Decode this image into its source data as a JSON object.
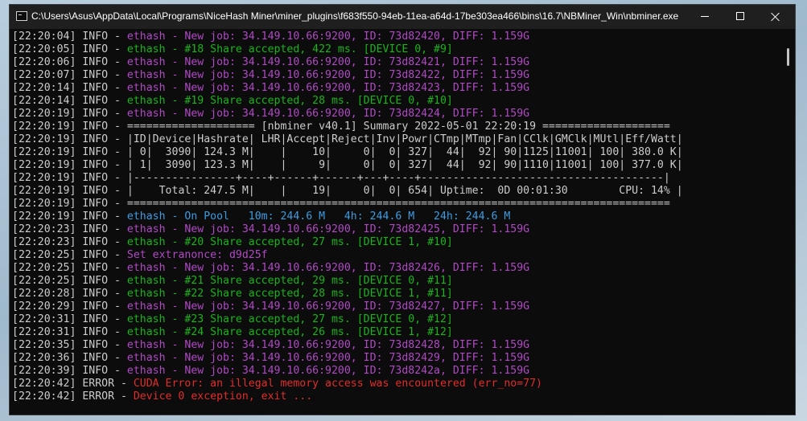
{
  "window": {
    "title": "C:\\Users\\Asus\\AppData\\Local\\Programs\\NiceHash Miner\\miner_plugins\\f683f550-94eb-11ea-a64d-17be303ea466\\bins\\16.7\\NBMiner_Win\\nbminer.exe",
    "icon": "console-icon",
    "controls": {
      "minimize": "minimize-icon",
      "maximize": "maximize-icon",
      "close": "close-icon"
    }
  },
  "colors": {
    "background": "#0c0c0c",
    "default_text": "#cccccc",
    "job": "#b148c6",
    "share": "#18b418",
    "pool": "#3c9be3",
    "error": "#e22c2c"
  },
  "console": {
    "lines": [
      {
        "prefix": "[22:20:04] INFO - ",
        "msg": "ethash - New job: 34.149.10.66:9200, ID: 73d82420, DIFF: 1.159G",
        "color": "magenta"
      },
      {
        "prefix": "[22:20:05] INFO - ",
        "msg": "ethash - #18 Share accepted, 422 ms. [DEVICE 0, #9]",
        "color": "green"
      },
      {
        "prefix": "[22:20:06] INFO - ",
        "msg": "ethash - New job: 34.149.10.66:9200, ID: 73d82421, DIFF: 1.159G",
        "color": "magenta"
      },
      {
        "prefix": "[22:20:07] INFO - ",
        "msg": "ethash - New job: 34.149.10.66:9200, ID: 73d82422, DIFF: 1.159G",
        "color": "magenta"
      },
      {
        "prefix": "[22:20:14] INFO - ",
        "msg": "ethash - New job: 34.149.10.66:9200, ID: 73d82423, DIFF: 1.159G",
        "color": "magenta"
      },
      {
        "prefix": "[22:20:14] INFO - ",
        "msg": "ethash - #19 Share accepted, 28 ms. [DEVICE 0, #10]",
        "color": "green"
      },
      {
        "prefix": "[22:20:19] INFO - ",
        "msg": "ethash - New job: 34.149.10.66:9200, ID: 73d82424, DIFF: 1.159G",
        "color": "magenta"
      },
      {
        "prefix": "[22:20:19] INFO - ",
        "msg": "==================== [nbminer v40.1] Summary 2022-05-01 22:20:19 ====================",
        "color": "white"
      },
      {
        "prefix": "[22:20:19] INFO - ",
        "msg": "|ID|Device|Hashrate| LHR|Accept|Reject|Inv|Powr|CTmp|MTmp|Fan|CClk|GMClk|MUtl|Eff/Watt|",
        "color": "white"
      },
      {
        "prefix": "[22:20:19] INFO - ",
        "msg": "| 0|  3090| 124.3 M|    |    10|     0|  0| 327|  44|  92| 90|1125|11001| 100| 380.0 K|",
        "color": "white"
      },
      {
        "prefix": "[22:20:19] INFO - ",
        "msg": "| 1|  3090| 123.3 M|    |     9|     0|  0| 327|  44|  92| 90|1110|11001| 100| 377.0 K|",
        "color": "white"
      },
      {
        "prefix": "[22:20:19] INFO - ",
        "msg": "|----------------+----+------+------+---+----+--------------------------------------|",
        "color": "white"
      },
      {
        "prefix": "[22:20:19] INFO - ",
        "msg": "|    Total: 247.5 M|    |    19|     0|  0| 654| Uptime:  0D 00:01:30        CPU: 14% |",
        "color": "white"
      },
      {
        "prefix": "[22:20:19] INFO - ",
        "msg": "=====================================================================================",
        "color": "white"
      },
      {
        "prefix": "[22:20:19] INFO - ",
        "msg": "ethash - On Pool   10m: 244.6 M   4h: 244.6 M   24h: 244.6 M",
        "color": "blue"
      },
      {
        "prefix": "[22:20:23] INFO - ",
        "msg": "ethash - New job: 34.149.10.66:9200, ID: 73d82425, DIFF: 1.159G",
        "color": "magenta"
      },
      {
        "prefix": "[22:20:23] INFO - ",
        "msg": "ethash - #20 Share accepted, 27 ms. [DEVICE 1, #10]",
        "color": "green"
      },
      {
        "prefix": "[22:20:25] INFO - ",
        "msg": "Set extranonce: d9d25f",
        "color": "magenta"
      },
      {
        "prefix": "[22:20:25] INFO - ",
        "msg": "ethash - New job: 34.149.10.66:9200, ID: 73d82426, DIFF: 1.159G",
        "color": "magenta"
      },
      {
        "prefix": "[22:20:25] INFO - ",
        "msg": "ethash - #21 Share accepted, 29 ms. [DEVICE 0, #11]",
        "color": "green"
      },
      {
        "prefix": "[22:20:28] INFO - ",
        "msg": "ethash - #22 Share accepted, 28 ms. [DEVICE 1, #11]",
        "color": "green"
      },
      {
        "prefix": "[22:20:29] INFO - ",
        "msg": "ethash - New job: 34.149.10.66:9200, ID: 73d82427, DIFF: 1.159G",
        "color": "magenta"
      },
      {
        "prefix": "[22:20:31] INFO - ",
        "msg": "ethash - #23 Share accepted, 27 ms. [DEVICE 0, #12]",
        "color": "green"
      },
      {
        "prefix": "[22:20:31] INFO - ",
        "msg": "ethash - #24 Share accepted, 26 ms. [DEVICE 1, #12]",
        "color": "green"
      },
      {
        "prefix": "[22:20:35] INFO - ",
        "msg": "ethash - New job: 34.149.10.66:9200, ID: 73d82428, DIFF: 1.159G",
        "color": "magenta"
      },
      {
        "prefix": "[22:20:36] INFO - ",
        "msg": "ethash - New job: 34.149.10.66:9200, ID: 73d82429, DIFF: 1.159G",
        "color": "magenta"
      },
      {
        "prefix": "[22:20:39] INFO - ",
        "msg": "ethash - New job: 34.149.10.66:9200, ID: 73d8242a, DIFF: 1.159G",
        "color": "magenta"
      },
      {
        "prefix": "[22:20:42] ERROR - ",
        "msg": "CUDA Error: an illegal memory access was encountered (err_no=77)",
        "color": "red"
      },
      {
        "prefix": "[22:20:42] ERROR - ",
        "msg": "Device 0 exception, exit ...",
        "color": "red"
      }
    ]
  }
}
